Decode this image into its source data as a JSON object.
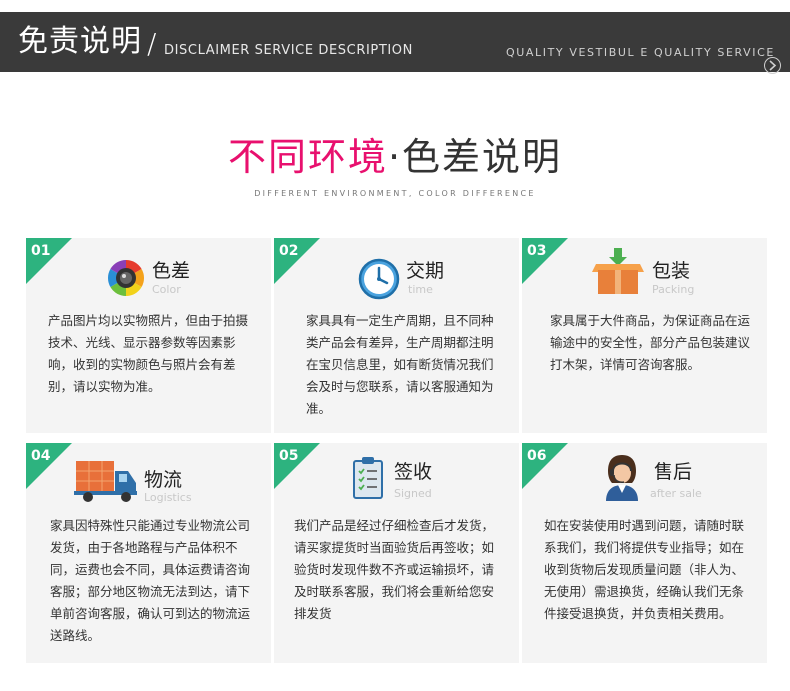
{
  "banner": {
    "title": "免责说明",
    "slash": "/",
    "subtitle": "DISCLAIMER SERVICE DESCRIPTION",
    "right_text": "QUALITY  VESTIBUL E QUALITY  SERVICE"
  },
  "heading": {
    "accent": "不同环境",
    "dot": "·",
    "main": "色差说明",
    "sub": "DIFFERENT ENVIRONMENT, COLOR DIFFERENCE"
  },
  "colors": {
    "banner_bg": "#3a3a3a",
    "accent_pink": "#e8106e",
    "corner_green": "#2db37f",
    "card_bg": "#f4f4f4"
  },
  "cards": [
    {
      "num": "01",
      "title": "色差",
      "subtitle": "Color",
      "icon": "camera-lens-icon",
      "body": "产品图片均以实物照片，但由于拍摄技术、光线、显示器参数等因素影响，收到的实物颜色与照片会有差别，请以实物为准。"
    },
    {
      "num": "02",
      "title": "交期",
      "subtitle": "time",
      "icon": "clock-icon",
      "body": "家具具有一定生产周期，且不同种类产品会有差异，生产周期都注明在宝贝信息里，如有断货情况我们会及时与您联系，请以客服通知为准。"
    },
    {
      "num": "03",
      "title": "包装",
      "subtitle": "Packing",
      "icon": "package-box-icon",
      "body": "家具属于大件商品，为保证商品在运输途中的安全性，部分产品包装建议打木架，详情可咨询客服。"
    },
    {
      "num": "04",
      "title": "物流",
      "subtitle": "Logistics",
      "icon": "delivery-truck-icon",
      "body": "家具因特殊性只能通过专业物流公司发货，由于各地路程与产品体积不同，运费也会不同，具体运费请咨询客服；部分地区物流无法到达，请下单前咨询客服，确认可到达的物流运送路线。"
    },
    {
      "num": "05",
      "title": "签收",
      "subtitle": "Signed",
      "icon": "clipboard-checklist-icon",
      "body": "我们产品是经过仔细检查后才发货，请买家提货时当面验货后再签收；如验货时发现件数不齐或运输损坏，请及时联系客服，我们将会重新给您安排发货"
    },
    {
      "num": "06",
      "title": "售后",
      "subtitle": "after sale",
      "icon": "customer-service-agent-icon",
      "body": "如在安装使用时遇到问题，请随时联系我们，我们将提供专业指导；如在收到货物后发现质量问题（非人为、无使用）需退换货，经确认我们无条件接受退换货，并负责相关费用。"
    }
  ]
}
